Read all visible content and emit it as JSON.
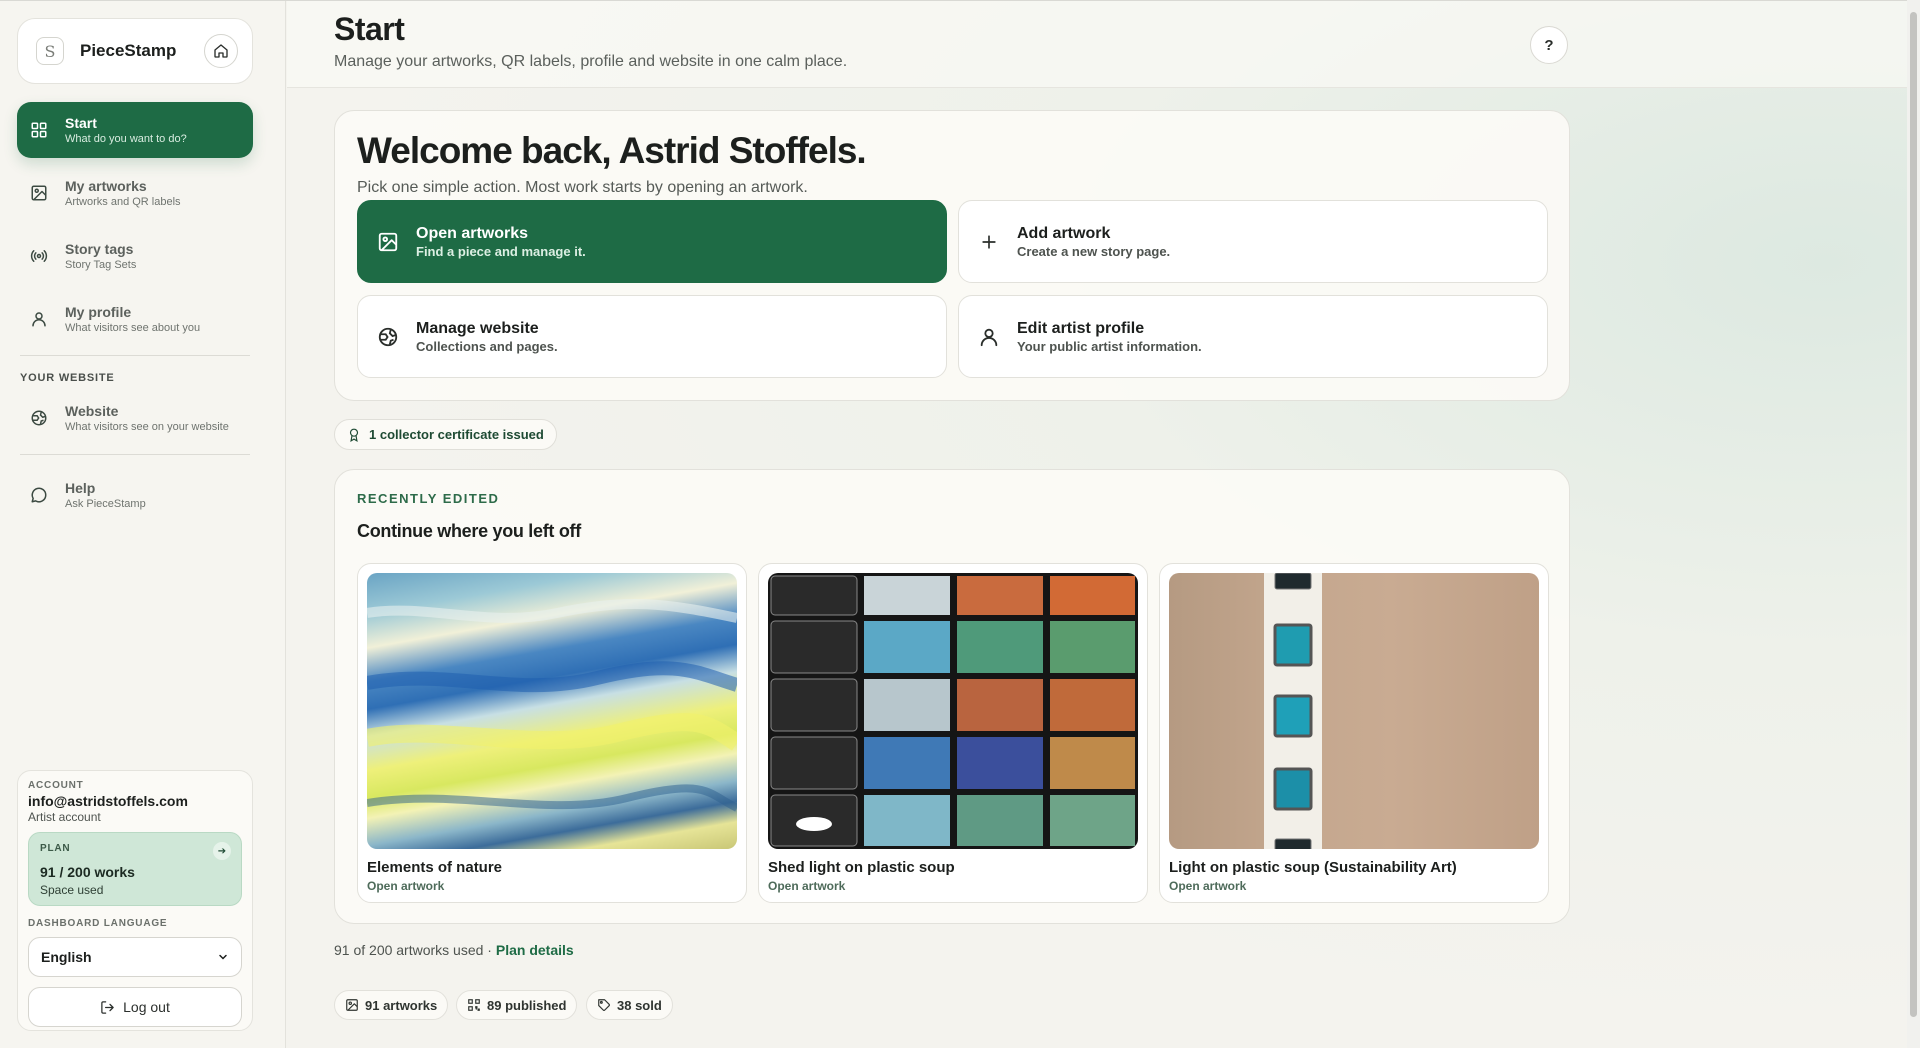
{
  "app": {
    "name": "PieceStamp"
  },
  "sidebar": {
    "items": [
      {
        "title": "Start",
        "sub": "What do you want to do?",
        "icon": "grid-icon",
        "active": true
      },
      {
        "title": "My artworks",
        "sub": "Artworks and QR labels",
        "icon": "image-icon"
      },
      {
        "title": "Story tags",
        "sub": "Story Tag Sets",
        "icon": "signal-icon"
      },
      {
        "title": "My profile",
        "sub": "What visitors see about you",
        "icon": "user-icon"
      }
    ],
    "section_label": "YOUR WEBSITE",
    "website": {
      "title": "Website",
      "sub": "What visitors see on your website",
      "icon": "globe-icon"
    },
    "help": {
      "title": "Help",
      "sub": "Ask PieceStamp",
      "icon": "chat-icon"
    }
  },
  "account": {
    "label": "ACCOUNT",
    "email": "info@astridstoffels.com",
    "type": "Artist account",
    "plan_label": "PLAN",
    "plan_works": "91 / 200 works",
    "plan_sub": "Space used",
    "plan_usage_fraction": 0.455,
    "lang_label": "DASHBOARD LANGUAGE",
    "lang_value": "English",
    "logout": "Log out"
  },
  "header": {
    "title": "Start",
    "subtitle": "Manage your artworks, QR labels, profile and website in one calm place.",
    "help": "?"
  },
  "welcome": {
    "heading": "Welcome back, Astrid Stoffels.",
    "lead": "Pick one simple action. Most work starts by opening an artwork.",
    "actions": [
      {
        "title": "Open artworks",
        "sub": "Find a piece and manage it.",
        "icon": "image-icon"
      },
      {
        "title": "Add artwork",
        "sub": "Create a new story page.",
        "icon": "plus-icon"
      },
      {
        "title": "Manage website",
        "sub": "Collections and pages.",
        "icon": "globe-icon"
      },
      {
        "title": "Edit artist profile",
        "sub": "Your public artist information.",
        "icon": "user-icon"
      }
    ]
  },
  "certificate": {
    "text": "1 collector certificate issued",
    "icon": "award-icon"
  },
  "recent": {
    "eyebrow": "RECENTLY EDITED",
    "heading": "Continue where you left off",
    "artworks": [
      {
        "title": "Elements of nature",
        "link": "Open artwork"
      },
      {
        "title": "Shed light on plastic soup",
        "link": "Open artwork"
      },
      {
        "title": "Light on plastic soup (Sustainability Art)",
        "link": "Open artwork"
      }
    ]
  },
  "footer": {
    "usage": "91 of 200 artworks used ·",
    "plan_link": "Plan details",
    "stats": [
      {
        "text": "91 artworks",
        "icon": "image-icon"
      },
      {
        "text": "89 published",
        "icon": "qr-icon"
      },
      {
        "text": "38 sold",
        "icon": "tag-icon"
      }
    ]
  },
  "colors": {
    "accent": "#1e6b45",
    "plan_bg": "#cfe7d7",
    "background": "#f4f3ee"
  }
}
